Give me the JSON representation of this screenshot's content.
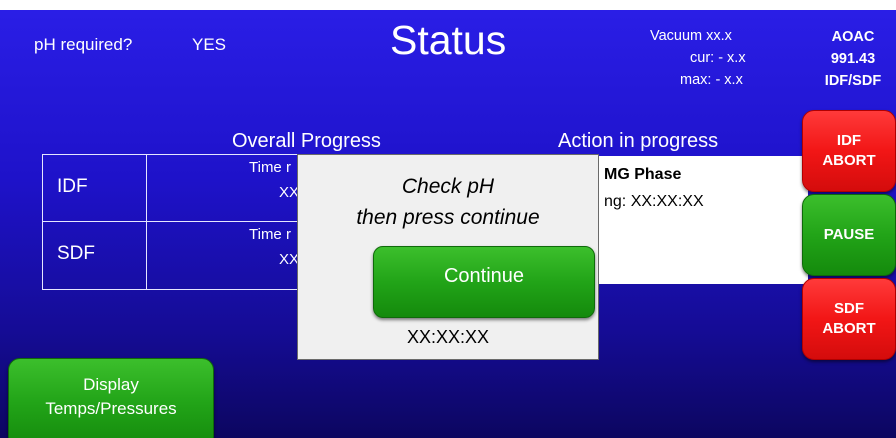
{
  "header": {
    "ph_required_label": "pH required?",
    "ph_required_value": "YES",
    "title": "Status",
    "vacuum": "Vacuum  xx.x",
    "vacuum_cur": "cur:  - x.x",
    "vacuum_max": "max:  - x.x",
    "method_line1": "AOAC",
    "method_line2": "991.43",
    "method_line3": "IDF/SDF"
  },
  "overall_progress": {
    "heading": "Overall Progress",
    "rows": [
      {
        "label": "IDF",
        "time_text": "Time r",
        "value_text": "XX"
      },
      {
        "label": "SDF",
        "time_text": "Time r",
        "value_text": "XX"
      }
    ]
  },
  "action_in_progress": {
    "heading": "Action in progress",
    "phase_text": "MG Phase",
    "remaining_text": "ng: XX:XX:XX"
  },
  "side_buttons": {
    "idf_abort_line1": "IDF",
    "idf_abort_line2": "ABORT",
    "pause": "PAUSE",
    "sdf_abort_line1": "SDF",
    "sdf_abort_line2": "ABORT"
  },
  "display_button": {
    "line1": "Display",
    "line2": "Temps/Pressures"
  },
  "modal": {
    "line1": "Check pH",
    "line2": "then press continue",
    "continue_label": "Continue",
    "timer": "XX:XX:XX"
  },
  "colors": {
    "background": "#1e12c9",
    "abort_red": "#f21616",
    "action_green": "#22a418",
    "modal_bg": "#f0f0f0"
  }
}
